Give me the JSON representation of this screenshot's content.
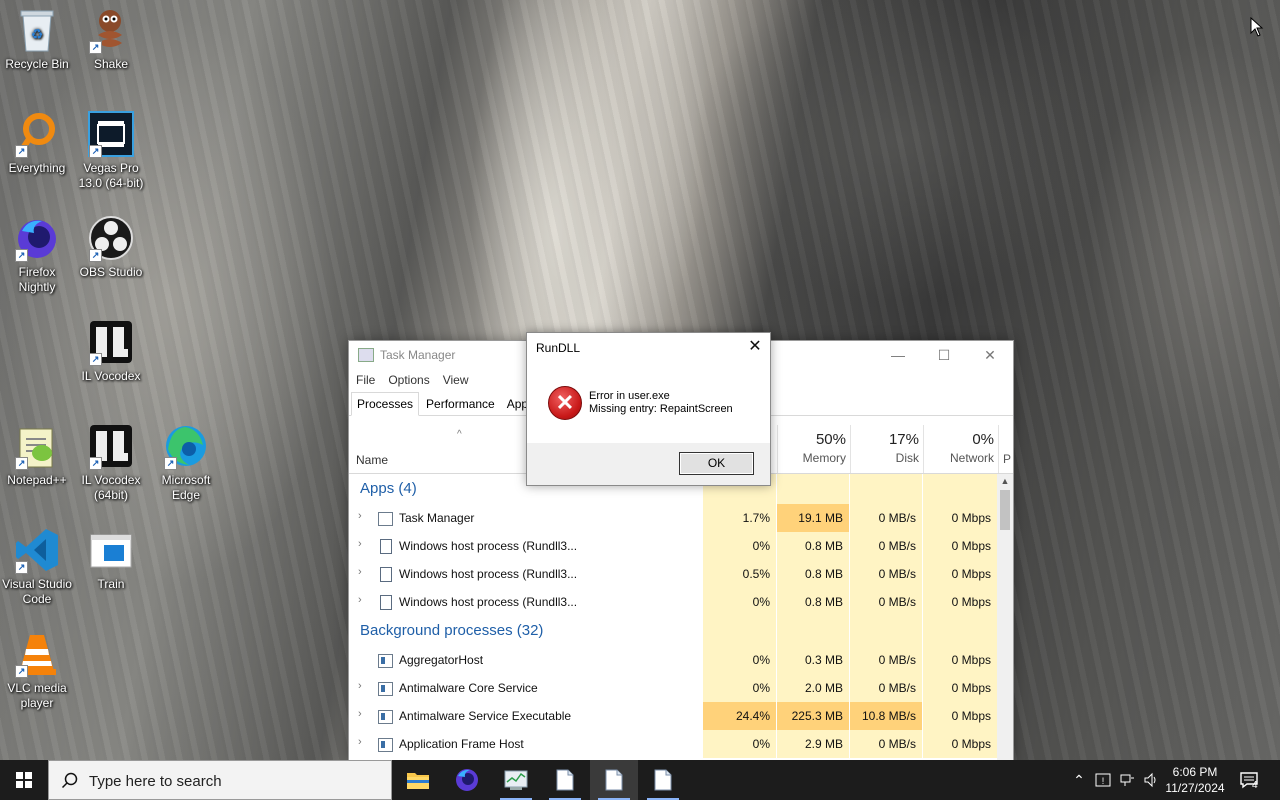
{
  "desktop": {
    "icons": [
      {
        "label": "Recycle Bin",
        "icon": "recycle-bin-icon"
      },
      {
        "label": "Shake",
        "icon": "snake-icon"
      },
      {
        "label": "Everything",
        "icon": "everything-icon"
      },
      {
        "label": "Vegas Pro 13.0 (64-bit)",
        "icon": "vegas-pro-icon"
      },
      {
        "label": "Firefox Nightly",
        "icon": "firefox-nightly-icon"
      },
      {
        "label": "OBS Studio",
        "icon": "obs-studio-icon"
      },
      {
        "label": "IL Vocodex",
        "icon": "il-vocodex-icon"
      },
      {
        "label": "Notepad++",
        "icon": "notepad-plus-plus-icon"
      },
      {
        "label": "IL Vocodex (64bit)",
        "icon": "il-vocodex-64-icon"
      },
      {
        "label": "Microsoft Edge",
        "icon": "edge-icon"
      },
      {
        "label": "Visual Studio Code",
        "icon": "vscode-icon"
      },
      {
        "label": "Train",
        "icon": "train-icon"
      },
      {
        "label": "VLC media player",
        "icon": "vlc-icon"
      }
    ]
  },
  "task_manager": {
    "title": "Task Manager",
    "menu": [
      "File",
      "Options",
      "View"
    ],
    "tabs": [
      "Processes",
      "Performance",
      "App h"
    ],
    "columns": {
      "name": "Name",
      "memory": {
        "pct": "50%",
        "label": "Memory"
      },
      "disk": {
        "pct": "17%",
        "label": "Disk"
      },
      "network": {
        "pct": "0%",
        "label": "Network"
      },
      "power": "P"
    },
    "groups": [
      {
        "title": "Apps (4)",
        "rows": [
          {
            "name": "Task Manager",
            "cpu": "1.7%",
            "memory": "19.1 MB",
            "disk": "0 MB/s",
            "network": "0 Mbps"
          },
          {
            "name": "Windows host process (Rundll3...",
            "cpu": "0%",
            "memory": "0.8 MB",
            "disk": "0 MB/s",
            "network": "0 Mbps"
          },
          {
            "name": "Windows host process (Rundll3...",
            "cpu": "0.5%",
            "memory": "0.8 MB",
            "disk": "0 MB/s",
            "network": "0 Mbps"
          },
          {
            "name": "Windows host process (Rundll3...",
            "cpu": "0%",
            "memory": "0.8 MB",
            "disk": "0 MB/s",
            "network": "0 Mbps"
          }
        ]
      },
      {
        "title": "Background processes (32)",
        "rows": [
          {
            "name": "AggregatorHost",
            "cpu": "0%",
            "memory": "0.3 MB",
            "disk": "0 MB/s",
            "network": "0 Mbps"
          },
          {
            "name": "Antimalware Core Service",
            "cpu": "0%",
            "memory": "2.0 MB",
            "disk": "0 MB/s",
            "network": "0 Mbps"
          },
          {
            "name": "Antimalware Service Executable",
            "cpu": "24.4%",
            "memory": "225.3 MB",
            "disk": "10.8 MB/s",
            "network": "0 Mbps"
          },
          {
            "name": "Application Frame Host",
            "cpu": "0%",
            "memory": "2.9 MB",
            "disk": "0 MB/s",
            "network": "0 Mbps"
          }
        ]
      }
    ],
    "colors": {
      "heat_light": "#fff4c4",
      "heat_mid": "#ffe9a8",
      "heat_high": "#ffd27a",
      "group_title": "#1f5fa8"
    }
  },
  "dialog": {
    "title": "RunDLL",
    "line1": "Error in user.exe",
    "line2": "Missing entry: RepaintScreen",
    "ok_label": "OK",
    "icon": "error-icon"
  },
  "taskbar": {
    "search_placeholder": "Type here to search",
    "time": "6:06 PM",
    "date": "11/27/2024",
    "notification_count": "4"
  }
}
